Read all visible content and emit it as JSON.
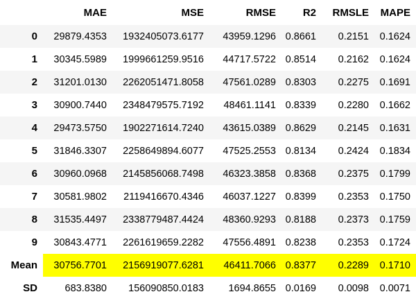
{
  "table": {
    "index_header": "",
    "columns": [
      "MAE",
      "MSE",
      "RMSE",
      "R2",
      "RMSLE",
      "MAPE"
    ],
    "rows": [
      {
        "index": "0",
        "values": [
          "29879.4353",
          "1932405073.6177",
          "43959.1296",
          "0.8661",
          "0.2151",
          "0.1624"
        ]
      },
      {
        "index": "1",
        "values": [
          "30345.5989",
          "1999661259.9516",
          "44717.5722",
          "0.8514",
          "0.2162",
          "0.1624"
        ]
      },
      {
        "index": "2",
        "values": [
          "31201.0130",
          "2262051471.8058",
          "47561.0289",
          "0.8303",
          "0.2275",
          "0.1691"
        ]
      },
      {
        "index": "3",
        "values": [
          "30900.7440",
          "2348479575.7192",
          "48461.1141",
          "0.8339",
          "0.2280",
          "0.1662"
        ]
      },
      {
        "index": "4",
        "values": [
          "29473.5750",
          "1902271614.7240",
          "43615.0389",
          "0.8629",
          "0.2145",
          "0.1631"
        ]
      },
      {
        "index": "5",
        "values": [
          "31846.3307",
          "2258649894.6077",
          "47525.2553",
          "0.8134",
          "0.2424",
          "0.1834"
        ]
      },
      {
        "index": "6",
        "values": [
          "30960.0968",
          "2145856068.7498",
          "46323.3858",
          "0.8368",
          "0.2375",
          "0.1799"
        ]
      },
      {
        "index": "7",
        "values": [
          "30581.9802",
          "2119416670.4346",
          "46037.1227",
          "0.8399",
          "0.2353",
          "0.1750"
        ]
      },
      {
        "index": "8",
        "values": [
          "31535.4497",
          "2338779487.4424",
          "48360.9293",
          "0.8188",
          "0.2373",
          "0.1759"
        ]
      },
      {
        "index": "9",
        "values": [
          "30843.4771",
          "2261619659.2282",
          "47556.4891",
          "0.8238",
          "0.2353",
          "0.1724"
        ]
      },
      {
        "index": "Mean",
        "values": [
          "30756.7701",
          "2156919077.6281",
          "46411.7066",
          "0.8377",
          "0.2289",
          "0.1710"
        ]
      },
      {
        "index": "SD",
        "values": [
          "683.8380",
          "156090850.0183",
          "1694.8655",
          "0.0169",
          "0.0098",
          "0.0071"
        ]
      }
    ]
  },
  "colors": {
    "highlight": "#ffff00",
    "stripe": "#f5f5f5",
    "background": "#ffffff",
    "text": "#000000"
  }
}
